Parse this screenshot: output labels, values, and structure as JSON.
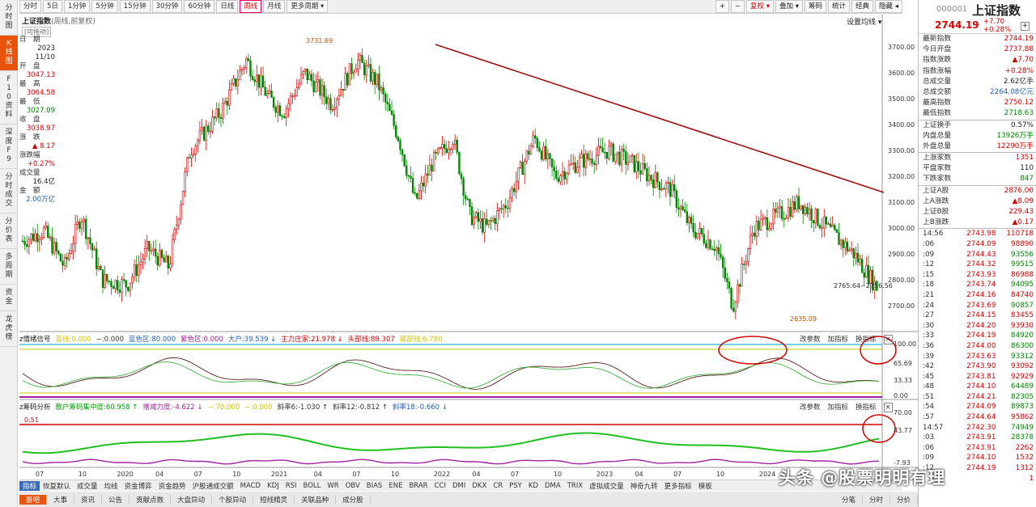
{
  "top_periods": [
    "分时",
    "5日",
    "1分钟",
    "5分钟",
    "15分钟",
    "30分钟",
    "60分钟",
    "日线",
    "周线",
    "月线",
    "更多周期 ▾"
  ],
  "active_period": "周线",
  "top_tools": [
    "+",
    "−",
    "复权 ▾",
    "叠加 ▾",
    "筹码",
    "统计",
    "经典",
    "隐藏 ◂"
  ],
  "left_tabs": [
    "分时图",
    "K线图",
    "F10资料",
    "深度F9",
    "分时成交",
    "分价表",
    "多周期",
    "资金",
    "龙虎榜"
  ],
  "chart_header": {
    "title": "上证指数",
    "sub": "(周线,前复权)",
    "drag": "[可拖动]",
    "set_ma": "设置均线 ▾"
  },
  "info_panel": [
    [
      "日　期",
      ""
    ],
    [
      "",
      "2023"
    ],
    [
      "",
      "11/10"
    ],
    [
      "开　盘",
      ""
    ],
    [
      "",
      "3047.13"
    ],
    [
      "最　高",
      ""
    ],
    [
      "",
      "3064.58"
    ],
    [
      "最　低",
      ""
    ],
    [
      "",
      "3027.09"
    ],
    [
      "收　盘",
      ""
    ],
    [
      "",
      "3038.97"
    ],
    [
      "涨　跌",
      ""
    ],
    [
      "",
      "▲ 8.17"
    ],
    [
      "涨跌幅",
      ""
    ],
    [
      "",
      "+0.27%"
    ],
    [
      "成交量",
      ""
    ],
    [
      "",
      "16.4亿"
    ],
    [
      "金　额",
      ""
    ],
    [
      "",
      "2.00万亿"
    ]
  ],
  "price_axis": [
    "3700.00",
    "3600.00",
    "3500.00",
    "3400.00",
    "3300.00",
    "3200.00",
    "3100.00",
    "3000.00",
    "2900.00",
    "2800.00",
    "2700.00"
  ],
  "annotations": {
    "high": "3731.69",
    "low": "2635.09",
    "range": "2765.64~2756.56"
  },
  "ind1": {
    "name": "z情绪信号",
    "items": [
      "蓝线:0.000",
      "−:0.000",
      "蓝色区:80.000",
      "紫色区:0.000",
      "大户:39.539 ↓",
      "主力庄家:21.978 ↓",
      "头部线:89.307",
      "底部线:6.780"
    ],
    "axis": [
      "100.00",
      "65.69",
      "33.33",
      "0.00"
    ]
  },
  "ind2": {
    "name": "z筹码分析",
    "items": [
      "散户筹码集中度:60.958 ↑",
      "增减力度:-4.622 ↓",
      "−:70.000",
      "−:0.000",
      "斜率6:-1.030 ↑",
      "斜率12:-0.812 ↑",
      "斜率18:-0.660 ↓"
    ],
    "axis": [
      "70.00",
      "43.77",
      "-7.93"
    ],
    "mark": "0.51"
  },
  "ind_ctrls": [
    "改参数",
    "加指标",
    "换指标"
  ],
  "x_axis": [
    [
      "07",
      0.015
    ],
    [
      "10",
      0.065
    ],
    [
      "2020",
      0.11
    ],
    [
      "04",
      0.155
    ],
    [
      "07",
      0.2
    ],
    [
      "10",
      0.245
    ],
    [
      "2021",
      0.29
    ],
    [
      "04",
      0.34
    ],
    [
      "07",
      0.385
    ],
    [
      "10",
      0.43
    ],
    [
      "2022",
      0.48
    ],
    [
      "04",
      0.525
    ],
    [
      "07",
      0.57
    ],
    [
      "10",
      0.62
    ],
    [
      "2023",
      0.67
    ],
    [
      "04",
      0.715
    ],
    [
      "07",
      0.76
    ],
    [
      "10",
      0.81
    ],
    [
      "2024",
      0.86
    ]
  ],
  "bottom_tabs": [
    "指标",
    "恢复默认",
    "成交量",
    "均线",
    "资金博弈",
    "资金趋势",
    "沪股通成交额",
    "MACD",
    "KDJ",
    "RSI",
    "BOLL",
    "WR",
    "OBV",
    "BIAS",
    "ENE",
    "BRAR",
    "CCI",
    "DMI",
    "DKX",
    "CR",
    "PSY",
    "KD",
    "DMA",
    "TRIX",
    "虚拟成交量",
    "神奇九转",
    "更多指标",
    "模板"
  ],
  "footer_tabs": [
    "股吧",
    "大事",
    "资讯",
    "公告",
    "贡献点数",
    "大盘异动",
    "个股异动",
    "短线精灵",
    "关联品种",
    "成分股"
  ],
  "footer_right": [
    "分笔",
    "分时",
    "分价"
  ],
  "right_panel": {
    "code": "000001",
    "name": "上证指数",
    "price": "2744.19",
    "chg": "+7.70",
    "pct": "+0.28%",
    "quote1": [
      [
        "最新指数",
        "2744.19",
        "red"
      ],
      [
        "今日开盘",
        "2737.88",
        "red"
      ],
      [
        "指数涨跌",
        "▲7.70",
        "red"
      ],
      [
        "指数涨幅",
        "+0.28%",
        "red"
      ],
      [
        "总成交量",
        "2.62亿手",
        ""
      ],
      [
        "总成交额",
        "2264.08亿元",
        "blu"
      ],
      [
        "最高指数",
        "2750.12",
        "red"
      ],
      [
        "最低指数",
        "2718.63",
        "grn"
      ]
    ],
    "quote2": [
      [
        "上证换手",
        "0.57%",
        ""
      ],
      [
        "内盘总量",
        "13926万手",
        "grn"
      ],
      [
        "外盘总量",
        "12290万手",
        "red"
      ]
    ],
    "quote3": [
      [
        "上涨家数",
        "1351",
        "red"
      ],
      [
        "平盘家数",
        "110",
        ""
      ],
      [
        "下跌家数",
        "847",
        "grn"
      ]
    ],
    "quote4": [
      [
        "上证A股",
        "2876.00",
        "red"
      ],
      [
        "上A涨跌",
        "▲8.09",
        "red"
      ],
      [
        "上证B股",
        "229.43",
        "red"
      ],
      [
        "上B涨跌",
        "▲0.17",
        "red"
      ]
    ],
    "ticks": [
      [
        "14:56",
        "2743.98",
        "110718",
        "red"
      ],
      [
        ":06",
        "2744.09",
        "98890",
        "red"
      ],
      [
        ":09",
        "2744.43",
        "93556",
        "grn"
      ],
      [
        ":12",
        "2744.32",
        "99515",
        "grn"
      ],
      [
        ":15",
        "2743.93",
        "86988",
        "red"
      ],
      [
        ":18",
        "2743.74",
        "94095",
        "grn"
      ],
      [
        ":21",
        "2744.16",
        "84740",
        "red"
      ],
      [
        ":24",
        "2743.69",
        "90857",
        "grn"
      ],
      [
        ":27",
        "2744.15",
        "83455",
        "red"
      ],
      [
        ":30",
        "2744.20",
        "93930",
        "red"
      ],
      [
        ":33",
        "2744.19",
        "84920",
        "grn"
      ],
      [
        ":36",
        "2744.00",
        "86300",
        "grn"
      ],
      [
        ":39",
        "2743.63",
        "93312",
        "grn"
      ],
      [
        ":42",
        "2743.90",
        "93092",
        "red"
      ],
      [
        ":45",
        "2743.81",
        "92929",
        "red"
      ],
      [
        ":48",
        "2744.10",
        "64489",
        "grn"
      ],
      [
        ":51",
        "2744.21",
        "82305",
        "grn"
      ],
      [
        ":54",
        "2744.09",
        "89873",
        "grn"
      ],
      [
        ":57",
        "2744.64",
        "95862",
        "red"
      ],
      [
        "14:57",
        "2742.30",
        "74949",
        "grn"
      ],
      [
        ":03",
        "2743.91",
        "28378",
        "grn"
      ],
      [
        ":06",
        "2743.91",
        "2262",
        "red"
      ],
      [
        ":09",
        "2744.10",
        "1532",
        "red"
      ],
      [
        ":12",
        "2744.19",
        "1312",
        "red"
      ],
      [
        "",
        "",
        "1",
        "red"
      ]
    ]
  },
  "watermark": "头条 @股票明明有理",
  "colors": {
    "up": "#d40000",
    "down": "#008800",
    "trend": "#a01010"
  }
}
